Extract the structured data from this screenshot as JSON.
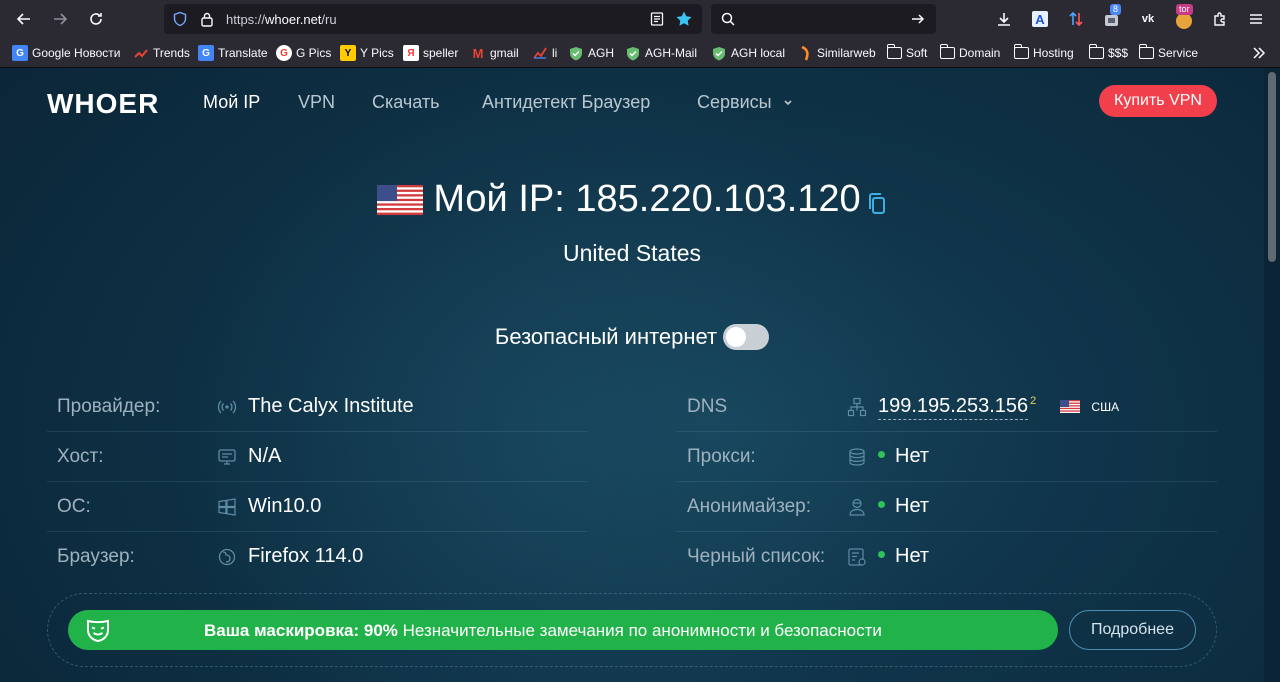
{
  "browser": {
    "url_prefix": "https://",
    "url_host": "whoer.net",
    "url_path": "/ru",
    "ext_badge_count": "8",
    "tor_badge": "tor"
  },
  "bookmarks": [
    {
      "label": "Google Новости"
    },
    {
      "label": "Trends"
    },
    {
      "label": "Translate"
    },
    {
      "label": "G Pics"
    },
    {
      "label": "Y Pics"
    },
    {
      "label": "speller"
    },
    {
      "label": "gmail"
    },
    {
      "label": "li"
    },
    {
      "label": "AGH"
    },
    {
      "label": "AGH-Mail"
    },
    {
      "label": "AGH local"
    },
    {
      "label": "Similarweb"
    },
    {
      "label": "Soft"
    },
    {
      "label": "Domain"
    },
    {
      "label": "Hosting"
    },
    {
      "label": "$$$"
    },
    {
      "label": "Service"
    }
  ],
  "site": {
    "logo": "WHOER",
    "menu": [
      "Мой IP",
      "VPN",
      "Скачать",
      "Антидетект Браузер",
      "Сервисы"
    ],
    "buy_label": "Купить VPN"
  },
  "ip": {
    "prefix": "Мой IP:",
    "address": "185.220.103.120",
    "country": "United States"
  },
  "safe_internet": {
    "label": "Безопасный интернет",
    "enabled": false
  },
  "left_info": [
    {
      "label": "Провайдер:",
      "value": "The Calyx Institute"
    },
    {
      "label": "Хост:",
      "value": "N/A"
    },
    {
      "label": "ОС:",
      "value": "Win10.0"
    },
    {
      "label": "Браузер:",
      "value": "Firefox 114.0"
    }
  ],
  "right_info": [
    {
      "label": "DNS",
      "value": "199.195.253.156",
      "sup": "2",
      "country": "США"
    },
    {
      "label": "Прокси:",
      "value": "Нет"
    },
    {
      "label": "Анонимайзер:",
      "value": "Нет"
    },
    {
      "label": "Черный список:",
      "value": "Нет"
    }
  ],
  "mask": {
    "title": "Ваша маскировка: 90%",
    "percent": 90,
    "note": "Незначительные замечания по анонимности и безопасности",
    "more_label": "Подробнее"
  },
  "colors": {
    "accent_red": "#f13f4c",
    "accent_green": "#21b24a",
    "status_green": "#2fc15a",
    "background": "#0f3348"
  }
}
